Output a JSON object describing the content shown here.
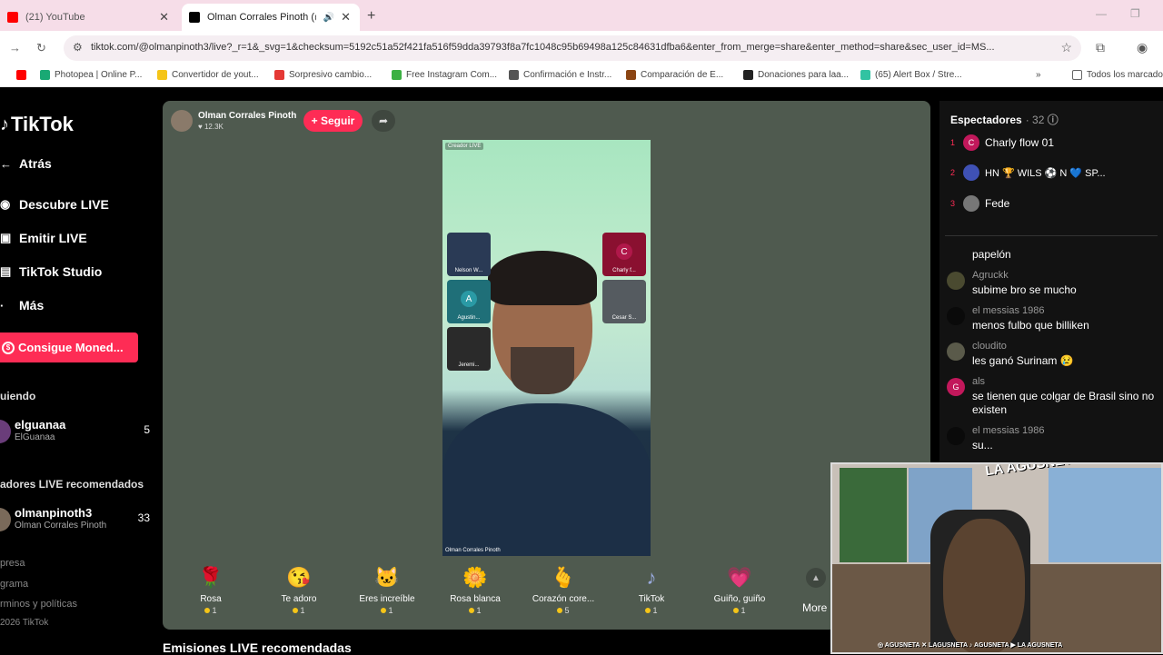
{
  "browser": {
    "tabs": [
      {
        "title": "(21) YouTube",
        "favicon_color": "#ff0000"
      },
      {
        "title": "Olman Corrales Pinoth (@o",
        "favicon_color": "#000000"
      }
    ],
    "url": "tiktok.com/@olmanpinoth3/live?_r=1&_svg=1&checksum=5192c51a52f421fa516f59dda39793f8a7fc1048c95b69498a125c84631dfba6&enter_from_merge=share&enter_method=share&sec_user_id=MS...",
    "bookmarks": [
      {
        "label": "",
        "color": "#ff0000"
      },
      {
        "label": "Photopea | Online P...",
        "color": "#19a974"
      },
      {
        "label": "Convertidor de yout...",
        "color": "#f5c518"
      },
      {
        "label": "Sorpresivo cambio...",
        "color": "#e53935"
      },
      {
        "label": "Free Instagram Com...",
        "color": "#3cb043"
      },
      {
        "label": "Confirmación e Instr...",
        "color": "#555555"
      },
      {
        "label": "Comparación de E...",
        "color": "#8b4513"
      },
      {
        "label": "Donaciones para laa...",
        "color": "#222222"
      },
      {
        "label": "(65) Alert Box / Stre...",
        "color": "#31c3a2"
      }
    ],
    "all_bookmarks": "Todos los marcado"
  },
  "sidebar": {
    "logo": "TikTok",
    "nav": [
      {
        "label": "Atrás",
        "icon": "arrow-left-icon"
      },
      {
        "label": "Descubre LIVE",
        "icon": "live-icon"
      },
      {
        "label": "Emitir LIVE",
        "icon": "broadcast-icon"
      },
      {
        "label": "TikTok Studio",
        "icon": "studio-icon"
      },
      {
        "label": "Más",
        "icon": "more-icon"
      }
    ],
    "coins_button": "Consigue Moned...",
    "following_title": "uiendo",
    "following": {
      "name": "elguanaa",
      "sub": "ElGuanaa",
      "count": "5"
    },
    "recommended_title": "adores LIVE recomendados",
    "recommended": {
      "name": "olmanpinoth3",
      "sub": "Olman Corrales Pinoth",
      "count": "33"
    },
    "footer": [
      "presa",
      "grama",
      "rminos y políticas",
      "2026 TikTok"
    ]
  },
  "live": {
    "host_name": "Olman Corrales Pinoth",
    "host_likes": "♥ 12.3K",
    "follow_label": "+ Seguir",
    "creator_tag": "Creador LIVE",
    "stream_watermark": "Olman Corrales Pinoth",
    "guests": [
      {
        "label": "Charly f...",
        "letter": "C"
      },
      {
        "label": "Agustin...",
        "letter": "A"
      },
      {
        "label": "Cesar S...",
        "letter": ""
      },
      {
        "label": "Jeremi...",
        "letter": ""
      },
      {
        "label": "Nelson W...",
        "letter": ""
      }
    ],
    "gifts": [
      {
        "name": "Rosa",
        "price": "1",
        "emoji": "🌹"
      },
      {
        "name": "Te adoro",
        "price": "1",
        "emoji": "😘"
      },
      {
        "name": "Eres increíble",
        "price": "1",
        "emoji": "🐱"
      },
      {
        "name": "Rosa blanca",
        "price": "1",
        "emoji": "🌼"
      },
      {
        "name": "Corazón core...",
        "price": "5",
        "emoji": "🫰"
      },
      {
        "name": "TikTok",
        "price": "1",
        "emoji": "♪"
      },
      {
        "name": "Guiño, guiño",
        "price": "1",
        "emoji": "💗"
      }
    ],
    "more_label": "More"
  },
  "recommended_streams_title": "Emisiones LIVE recomendadas",
  "chat": {
    "spectators_label": "Espectadores",
    "spectators_count": "· 32",
    "top_viewers": [
      {
        "rank": "1",
        "name": "Charly flow 01",
        "letter": "C",
        "color": "#c2185b"
      },
      {
        "rank": "2",
        "name": "HN 🏆 WILS ⚽ N 💙 SP...",
        "letter": "",
        "color": "#3f51b5"
      },
      {
        "rank": "3",
        "name": "Fede",
        "letter": "",
        "color": "#777777"
      }
    ],
    "messages": [
      {
        "user": "",
        "text": "papelón",
        "letter": ""
      },
      {
        "user": "Agruckk",
        "text": "subime bro se mucho",
        "letter": ""
      },
      {
        "user": "el messias 1986",
        "text": "menos fulbo que billiken",
        "letter": ""
      },
      {
        "user": "cloudito",
        "text": "les ganó Surinam 😢",
        "letter": ""
      },
      {
        "user": "als",
        "text": "se tienen que colgar de Brasil sino no existen",
        "letter": "G"
      },
      {
        "user": "el messias 1986",
        "text": "su...",
        "letter": ""
      }
    ]
  },
  "webcam": {
    "brand": "LA AGUSNETA",
    "social": "◎ AGUSNETA  ✕ LAGUSNETA  ♪ AGUSNETA  ▶ LA AGUSNETA"
  }
}
